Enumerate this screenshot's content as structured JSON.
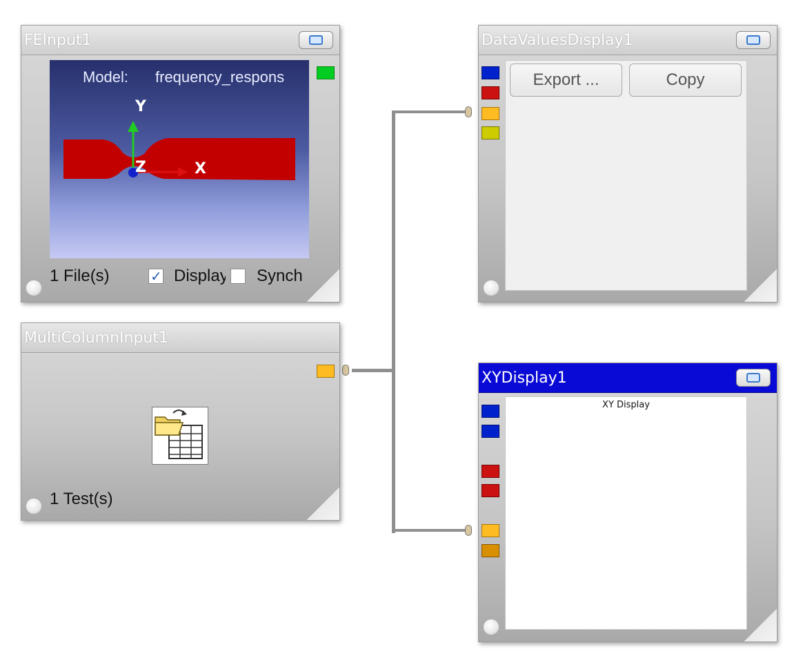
{
  "colors": {
    "port_blue": "#0022cc",
    "port_red": "#cc1111",
    "port_orange": "#ffbb22",
    "port_yellow": "#cccc00",
    "port_dark_orange": "#d99000",
    "status_green": "#00cc22",
    "active_title": "#0a0ad6"
  },
  "icons": {
    "maximize": "maximize-icon",
    "status": "status-light-icon",
    "file_open": "file-open-table-icon"
  },
  "fe_input": {
    "title": "FEInput1",
    "model_label": "Model:",
    "model_name": "frequency_respons",
    "axis_y": "Y",
    "axis_x": "X",
    "axis_z": "Z",
    "files": "1 File(s)",
    "display_label": "Display",
    "display_checked": true,
    "sync_label": "Synch",
    "sync_checked": false
  },
  "multi_column_input": {
    "title": "MultiColumnInput1",
    "tests": "1 Test(s)"
  },
  "data_values_display": {
    "title": "DataValuesDisplay1",
    "export_label": "Export ...",
    "copy_label": "Copy"
  },
  "xy_display": {
    "title": "XYDisplay1",
    "plot_title": "XY Display"
  }
}
